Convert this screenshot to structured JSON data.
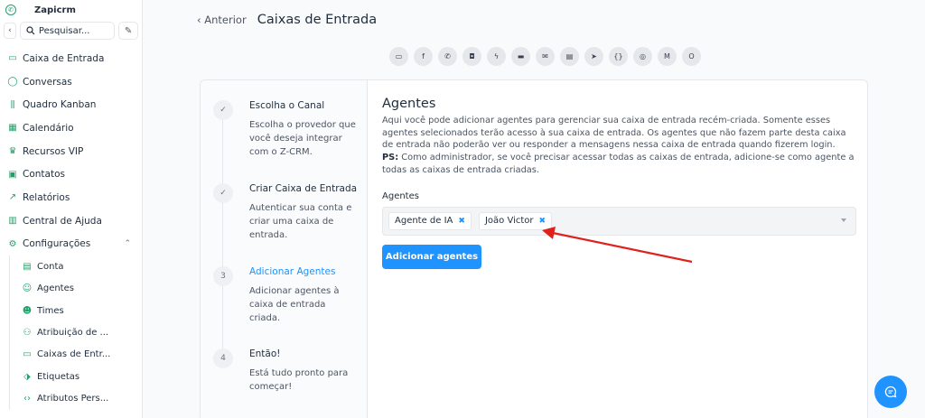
{
  "brand": {
    "name": "Zapicrm"
  },
  "search": {
    "placeholder": "Pesquisar..."
  },
  "sidebar": {
    "items": [
      {
        "label": "Caixa de Entrada",
        "icon": "inbox-icon"
      },
      {
        "label": "Conversas",
        "icon": "chat-icon"
      },
      {
        "label": "Quadro Kanban",
        "icon": "kanban-icon"
      },
      {
        "label": "Calendário",
        "icon": "calendar-icon"
      },
      {
        "label": "Recursos VIP",
        "icon": "crown-icon"
      },
      {
        "label": "Contatos",
        "icon": "contacts-icon"
      },
      {
        "label": "Relatórios",
        "icon": "chart-icon"
      },
      {
        "label": "Central de Ajuda",
        "icon": "book-icon"
      },
      {
        "label": "Configurações",
        "icon": "gear-icon"
      }
    ],
    "sub_items": [
      {
        "label": "Conta",
        "icon": "building-icon"
      },
      {
        "label": "Agentes",
        "icon": "user-icon"
      },
      {
        "label": "Times",
        "icon": "team-icon"
      },
      {
        "label": "Atribuição de ...",
        "icon": "assign-icon"
      },
      {
        "label": "Caixas de Entr...",
        "icon": "inbox-icon"
      },
      {
        "label": "Etiquetas",
        "icon": "tag-icon"
      },
      {
        "label": "Atributos Pers...",
        "icon": "code-icon"
      }
    ]
  },
  "header": {
    "back_label": "Anterior",
    "title": "Caixas de Entrada"
  },
  "channels": [
    "sms-icon",
    "facebook-icon",
    "whatsapp-icon",
    "instagram-icon",
    "messenger-icon",
    "website-icon",
    "email-icon",
    "chat-icon",
    "telegram-icon",
    "api-icon",
    "line-icon",
    "gmail-icon",
    "outlook-icon"
  ],
  "steps": [
    {
      "num": "✓",
      "title": "Escolha o Canal",
      "desc": "Escolha o provedor que você deseja integrar com o Z-CRM."
    },
    {
      "num": "✓",
      "title": "Criar Caixa de Entrada",
      "desc": "Autenticar sua conta e criar uma caixa de entrada."
    },
    {
      "num": "3",
      "title": "Adicionar Agentes",
      "desc": "Adicionar agentes à caixa de entrada criada."
    },
    {
      "num": "4",
      "title": "Então!",
      "desc": "Está tudo pronto para começar!"
    }
  ],
  "content": {
    "heading": "Agentes",
    "description": "Aqui você pode adicionar agentes para gerenciar sua caixa de entrada recém-criada. Somente esses agentes selecionados terão acesso à sua caixa de entrada. Os agentes que não fazem parte desta caixa de entrada não poderão ver ou responder a mensagens nessa caixa de entrada quando fizerem login.",
    "ps_label": "PS:",
    "ps_text": " Como administrador, se você precisar acessar todas as caixas de entrada, adicione-se como agente a todas as caixas de entrada criadas.",
    "field_label": "Agentes",
    "tags": [
      "Agente de IA",
      "João Victor"
    ],
    "button_label": "Adicionar agentes"
  },
  "colors": {
    "accent": "#1f93ff",
    "brand": "#22a06b",
    "annotation_arrow": "#e0201b"
  }
}
